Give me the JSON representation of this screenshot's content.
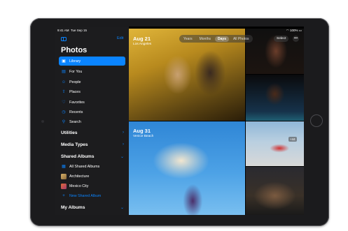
{
  "status": {
    "time": "9:41 AM",
    "date": "Tue Sep 15",
    "battery": "100%"
  },
  "sidebar": {
    "edit_label": "Edit",
    "title": "Photos",
    "items": [
      {
        "label": "Library",
        "icon": "library-icon",
        "selected": true
      },
      {
        "label": "For You",
        "icon": "for-you-icon"
      },
      {
        "label": "People",
        "icon": "people-icon"
      },
      {
        "label": "Places",
        "icon": "places-icon"
      },
      {
        "label": "Favorites",
        "icon": "heart-icon"
      },
      {
        "label": "Recents",
        "icon": "clock-icon"
      },
      {
        "label": "Search",
        "icon": "search-icon"
      }
    ],
    "sections": {
      "utilities": "Utilities",
      "media_types": "Media Types",
      "shared_albums": "Shared Albums",
      "my_albums": "My Albums"
    },
    "shared_albums": [
      {
        "label": "All Shared Albums"
      },
      {
        "label": "Architecture"
      },
      {
        "label": "Mexico City"
      },
      {
        "label": "New Shared Album"
      }
    ]
  },
  "main": {
    "segments": [
      "Years",
      "Months",
      "Days",
      "All Photos"
    ],
    "active_segment": "Days",
    "select_label": "Select",
    "more_label": "•••",
    "groups": [
      {
        "date": "Aug 21",
        "place": "Los Angeles"
      },
      {
        "date": "Aug 31",
        "place": "Venice Beach"
      }
    ],
    "more_count": "+44"
  },
  "colors": {
    "accent": "#0a84ff",
    "sidebar_bg": "#1c1c1e",
    "bezel": "#1b1b1d"
  }
}
